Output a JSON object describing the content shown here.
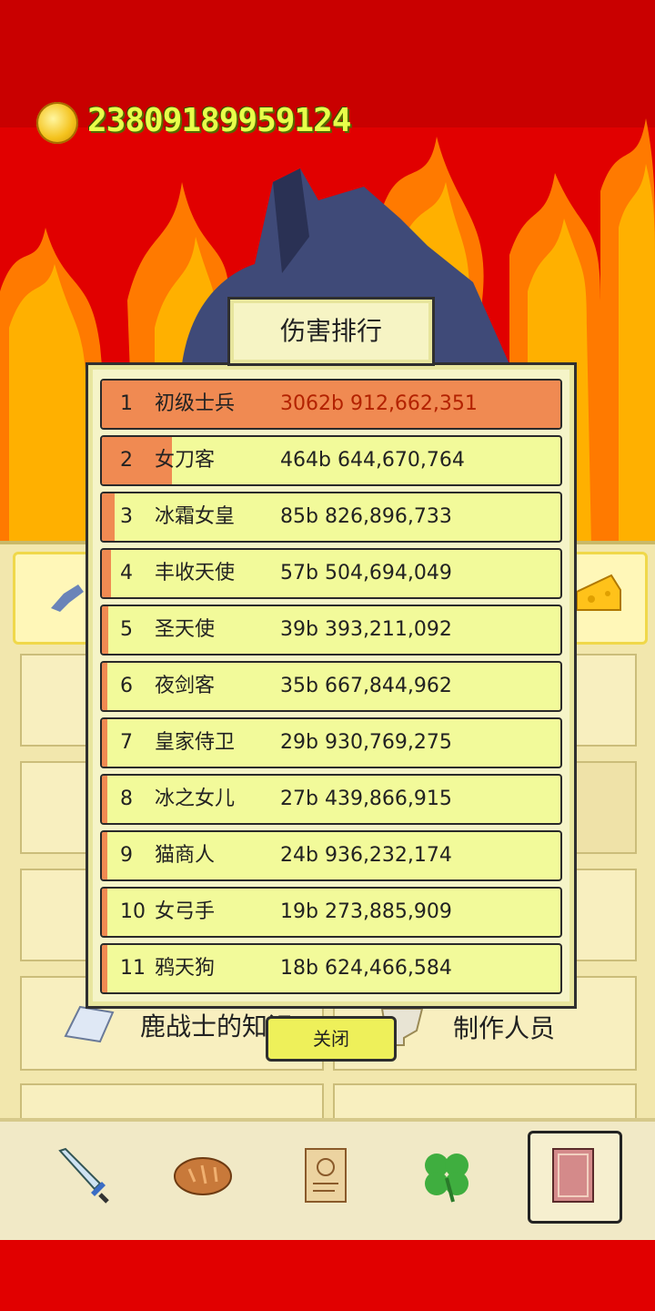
{
  "currency": {
    "icon": "gold-coin-icon",
    "value": "23809189959124"
  },
  "dialog": {
    "title": "伤害排行",
    "close_label": "关闭",
    "rows": [
      {
        "rank": "1",
        "name": "初级士兵",
        "value": "3062b 912,662,351",
        "share": 1.0
      },
      {
        "rank": "2",
        "name": "女刀客",
        "value": "464b 644,670,764",
        "share": 0.152
      },
      {
        "rank": "3",
        "name": "冰霜女皇",
        "value": "85b 826,896,733",
        "share": 0.028
      },
      {
        "rank": "4",
        "name": "丰收天使",
        "value": "57b 504,694,049",
        "share": 0.019
      },
      {
        "rank": "5",
        "name": "圣天使",
        "value": "39b 393,211,092",
        "share": 0.013
      },
      {
        "rank": "6",
        "name": "夜剑客",
        "value": "35b 667,844,962",
        "share": 0.012
      },
      {
        "rank": "7",
        "name": "皇家侍卫",
        "value": "29b 930,769,275",
        "share": 0.01
      },
      {
        "rank": "8",
        "name": "冰之女儿",
        "value": "27b 439,866,915",
        "share": 0.009
      },
      {
        "rank": "9",
        "name": "猫商人",
        "value": "24b 936,232,174",
        "share": 0.008
      },
      {
        "rank": "10",
        "name": "女弓手",
        "value": "19b 273,885,909",
        "share": 0.006
      },
      {
        "rank": "11",
        "name": "鸦天狗",
        "value": "18b 624,466,584",
        "share": 0.006
      }
    ]
  },
  "menu": {
    "knowledge_label": "鹿战士的知识",
    "credits_label": "制作人员"
  },
  "tabs": [
    "sword-icon",
    "bread-icon",
    "scroll-icon",
    "clover-icon",
    "book-icon"
  ],
  "colors": {
    "bar": "#f08a52",
    "row": "#f2fa9a",
    "coin_text": "#e8ff4a"
  }
}
